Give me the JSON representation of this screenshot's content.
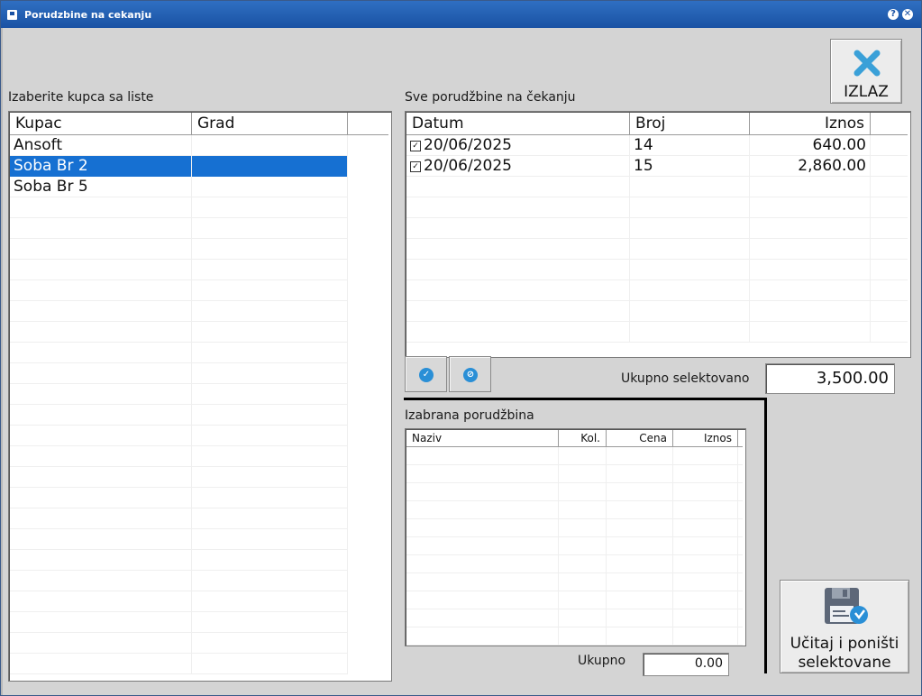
{
  "window": {
    "title": "Porudzbine na cekanju"
  },
  "exit_button": {
    "label": "IZLAZ",
    "icon": "close-x-icon"
  },
  "customers": {
    "section_label": "Izaberite kupca sa liste",
    "columns": [
      "Kupac",
      "Grad"
    ],
    "rows": [
      {
        "kupac": "Ansoft",
        "grad": ""
      },
      {
        "kupac": "Soba Br 2",
        "grad": "",
        "selected": true
      },
      {
        "kupac": "Soba Br 5",
        "grad": ""
      }
    ]
  },
  "orders": {
    "section_label": "Sve porudžbine na čekanju",
    "columns": [
      "Datum",
      "Broj",
      "Iznos"
    ],
    "rows": [
      {
        "checked": true,
        "datum": "20/06/2025",
        "broj": "14",
        "iznos": "640.00"
      },
      {
        "checked": true,
        "datum": "20/06/2025",
        "broj": "15",
        "iznos": "2,860.00"
      }
    ]
  },
  "selection": {
    "select_all_icon": "check-circle-icon",
    "deselect_all_icon": "clear-circle-icon"
  },
  "total_selected": {
    "label": "Ukupno selektovano",
    "value": "3,500.00"
  },
  "order_items": {
    "section_label": "Izabrana porudžbina",
    "columns": [
      "Naziv",
      "Kol.",
      "Cena",
      "Iznos"
    ]
  },
  "total": {
    "label": "Ukupno",
    "value": "0.00"
  },
  "load_button": {
    "label_line1": "Učitaj i poništi",
    "label_line2": "selektovane",
    "icon": "floppy-disk-icon"
  }
}
